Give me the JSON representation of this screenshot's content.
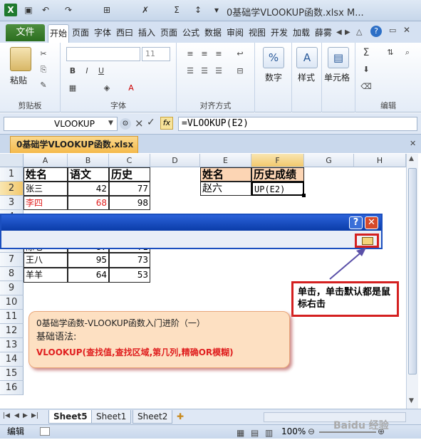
{
  "window": {
    "title": "0基础学VLOOKUP函数.xlsx M..."
  },
  "ribbon_tabs": [
    "文件",
    "开始",
    "页面",
    "字体",
    "西曰",
    "插入",
    "页面",
    "公式",
    "数据",
    "审阅",
    "视图",
    "开发",
    "加载",
    "薛雾"
  ],
  "ribbon": {
    "clipboard": {
      "paste": "粘贴",
      "group": "剪贴板"
    },
    "font": {
      "size": "11",
      "group": "字体"
    },
    "align": {
      "group": "对齐方式"
    },
    "number": {
      "label": "数字",
      "percent": "%"
    },
    "styles": {
      "label": "样式"
    },
    "cells": {
      "label": "单元格"
    },
    "edit": {
      "group": "编辑",
      "sigma": "Σ"
    }
  },
  "formula_bar": {
    "name_box": "VLOOKUP",
    "fx": "fx",
    "formula": "=VLOOKUP(E2)",
    "cancel": "×",
    "confirm": "✓"
  },
  "doc_tab": "0基础学VLOOKUP函数.xlsx",
  "columns": [
    "A",
    "B",
    "C",
    "D",
    "E",
    "F",
    "G",
    "H"
  ],
  "rows": [
    "1",
    "2",
    "3",
    "4",
    "5",
    "6",
    "7",
    "8",
    "9",
    "10",
    "11",
    "12",
    "13",
    "14",
    "15",
    "16"
  ],
  "table": {
    "headers": [
      "姓名",
      "语文",
      "历史"
    ],
    "rows": [
      {
        "name": "张三",
        "chinese": "42",
        "history": "77"
      },
      {
        "name": "李四",
        "chinese": "68",
        "history": "98"
      },
      {
        "name": "陈七",
        "chinese": "87",
        "history": "71"
      },
      {
        "name": "王八",
        "chinese": "95",
        "history": "73"
      },
      {
        "name": "羊羊",
        "chinese": "64",
        "history": "53"
      }
    ]
  },
  "lookup": {
    "h1": "姓名",
    "h2": "历史成绩",
    "name": "赵六",
    "formula_part": "UP(E2)"
  },
  "dialog": {
    "help": "?",
    "close": "✕"
  },
  "callout": {
    "line1": "0基础学函数-VLOOKUP函数入门进阶（一）",
    "line2": "基础语法:",
    "line3": "VLOOKUP(查找值,查找区域,第几列,精确OR模糊)"
  },
  "note": "单击，单击默认都是鼠标右击",
  "sheets": [
    "Sheet5",
    "Sheet1",
    "Sheet2"
  ],
  "status": {
    "mode": "编辑",
    "zoom": "100%",
    "watermark": "Baidu 经验"
  },
  "colors": {
    "accent": "#2b6e1f",
    "red": "#d42020"
  }
}
